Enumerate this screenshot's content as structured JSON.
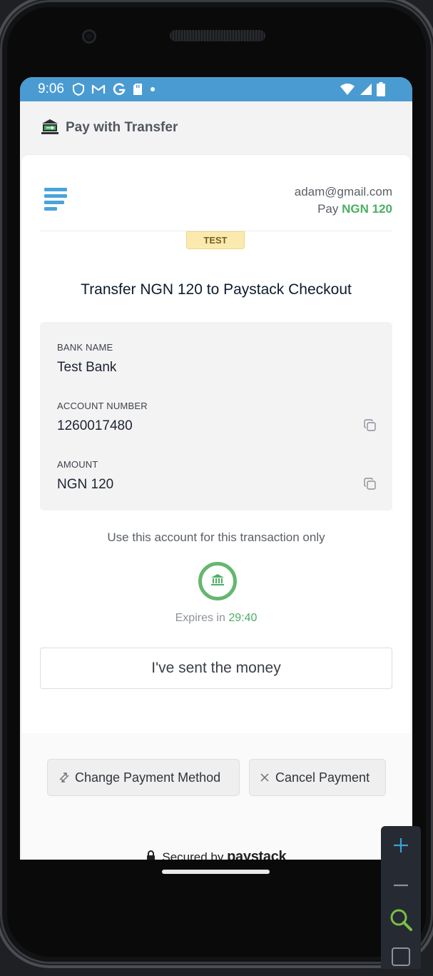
{
  "status_bar": {
    "time": "9:06"
  },
  "app_bar": {
    "title": "Pay with Transfer"
  },
  "merchant": {
    "email": "adam@gmail.com",
    "pay_label": "Pay",
    "amount": "NGN 120"
  },
  "badge": {
    "text": "TEST"
  },
  "headline": "Transfer NGN 120 to Paystack Checkout",
  "details": {
    "bank_label": "BANK NAME",
    "bank_value": "Test Bank",
    "account_label": "ACCOUNT NUMBER",
    "account_value": "1260017480",
    "amount_label": "AMOUNT",
    "amount_value": "NGN 120"
  },
  "note": "Use this account for this transaction only",
  "expires": {
    "label": "Expires in",
    "time": "29:40"
  },
  "sent_button": "I've sent the money",
  "actions": {
    "change_method": "Change Payment Method",
    "cancel": "Cancel Payment"
  },
  "footer": {
    "secured_by": "Secured by",
    "brand": "paystack"
  },
  "colors": {
    "status_bar": "#4a9bd1",
    "accent_green": "#4caf64",
    "logo_blue": "#4aa3dc",
    "badge_bg": "#fbeab0"
  },
  "icons": [
    "shield-icon",
    "gmail-icon",
    "google-icon",
    "sd-card-icon",
    "dot-icon",
    "wifi-icon",
    "signal-icon",
    "battery-icon",
    "bank-icon",
    "copy-icon",
    "swap-icon",
    "close-icon",
    "lock-icon",
    "zoom-in-icon",
    "zoom-out-icon",
    "zoom-reset-icon",
    "fullscreen-icon"
  ]
}
